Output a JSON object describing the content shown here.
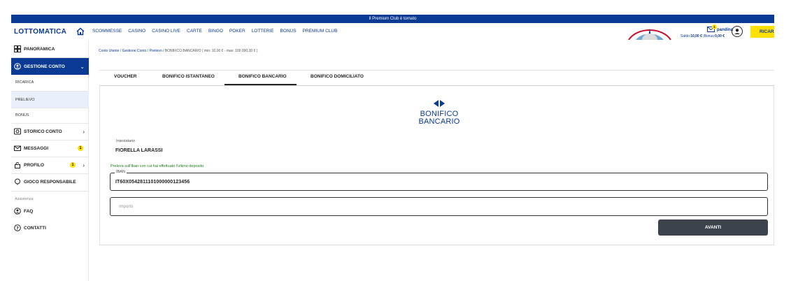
{
  "topbar": {
    "announcement": "Il Premium Club è tornato"
  },
  "header": {
    "logo": "LOTTOMATICA",
    "nav": [
      "SCOMMESSE",
      "CASINO",
      "CASINO LIVE",
      "CARTE",
      "BINGO",
      "POKER",
      "LOTTERIE",
      "BONUS",
      "PREMIUM CLUB"
    ],
    "mail_count": "1",
    "username": "pandina",
    "saldo_label": "Saldo:",
    "saldo_value": "10,00 €",
    "bonus_label": "|Bonus:",
    "bonus_value": "0,00 €",
    "ricarica_label": "RICARICA"
  },
  "sidebar": {
    "panoramica": "PANORAMICA",
    "gestione_conto": "GESTIONE CONTO",
    "sub_items": [
      "RICARICA",
      "PRELIEVO",
      "BONUS"
    ],
    "storico_conto": "STORICO CONTO",
    "messaggi": "MESSAGGI",
    "messaggi_badge": "1",
    "profilo": "PROFILO",
    "profilo_badge": "1",
    "gioco_responsabile": "GIOCO RESPONSABILE",
    "assistenza_label": "Assistenza",
    "faq": "FAQ",
    "contatti": "CONTATTI"
  },
  "breadcrumb": {
    "items": [
      "Conto Utente",
      "Gestione Conto",
      "Prelievo"
    ],
    "separator": "/",
    "current": "BONIFICO BANCARIO ( min: 10,00 € - max: 100.000,00 € )"
  },
  "tabs": [
    "VOUCHER",
    "BONIFICO ISTANTANEO",
    "BONIFICO BANCARIO",
    "BONIFICO DOMICILIATO"
  ],
  "active_tab": "BONIFICO BANCARIO",
  "form": {
    "logo_line1": "BONIFICO",
    "logo_line2": "BANCARIO",
    "intestatario_label": "Intestatario",
    "intestatario_value": "FIORELLA LARASSI",
    "hint": "Preleva sull'Iban con cui hai effettuato l'ultimo deposito",
    "iban_label": "IBAN",
    "iban_value": "IT60X0542811101000000123456",
    "importo_placeholder": "Importo",
    "submit_label": "AVANTI"
  },
  "colors": {
    "brand_blue": "#0a3a93",
    "accent_yellow": "#ffe000",
    "button_dark": "#3c434d",
    "hint_green": "#1d7a1d"
  }
}
